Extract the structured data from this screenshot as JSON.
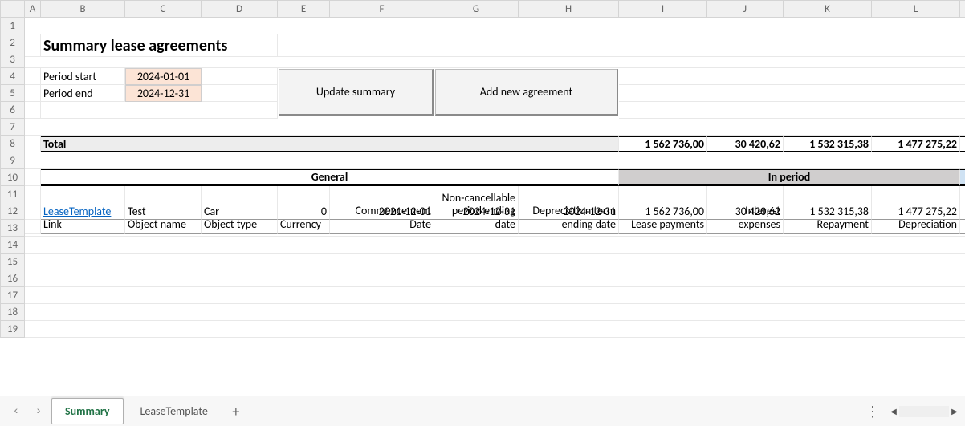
{
  "columns": [
    "A",
    "B",
    "C",
    "D",
    "E",
    "F",
    "G",
    "H",
    "I",
    "J",
    "K",
    "L",
    ""
  ],
  "rows": [
    "1",
    "2",
    "3",
    "4",
    "5",
    "6",
    "7",
    "8",
    "9",
    "10",
    "11",
    "12",
    "13",
    "14",
    "15",
    "16",
    "17",
    "18",
    "19"
  ],
  "title": "Summary lease agreements",
  "period": {
    "start_label": "Period start",
    "end_label": "Period end",
    "start": "2024-01-01",
    "end": "2024-12-31"
  },
  "buttons": {
    "update": "Update summary",
    "addnew": "Add new agreement"
  },
  "total": {
    "label": "Total",
    "lease_payments": "1 562 736,00",
    "interest_expenses": "30 420,62",
    "repayment": "1 532 315,38",
    "depreciation": "1 477 275,22"
  },
  "sections": {
    "general": "General",
    "in_period": "In period"
  },
  "headers": {
    "link": "Link",
    "object_name": "Object name",
    "object_type": "Object type",
    "currency": "Currency",
    "commencement_date": "Commencement Date",
    "noncancel_date": "Non-cancellable period ending date",
    "deprec_term_date": "Depreciation term ending date",
    "lease_payments": "Lease payments",
    "interest_expenses": "Interest expenses",
    "repayment": "Repayment",
    "depreciation": "Depreciation"
  },
  "data_rows": [
    {
      "link": "LeaseTemplate",
      "object_name": "Test",
      "object_type": "Car",
      "currency": "0",
      "commencement_date": "2021-12-01",
      "noncancel_date": "2024-12-31",
      "deprec_term_date": "2024-12-31",
      "lease_payments": "1 562 736,00",
      "interest_expenses": "30 420,62",
      "repayment": "1 532 315,38",
      "depreciation": "1 477 275,22"
    }
  ],
  "tabs": {
    "active": "Summary",
    "other": "LeaseTemplate"
  },
  "chart_data": {
    "type": "table",
    "title": "Summary lease agreements",
    "columns": [
      "Link",
      "Object name",
      "Object type",
      "Currency",
      "Commencement Date",
      "Non-cancellable period ending date",
      "Depreciation term ending date",
      "Lease payments",
      "Interest expenses",
      "Repayment",
      "Depreciation"
    ],
    "rows": [
      [
        "LeaseTemplate",
        "Test",
        "Car",
        0,
        "2021-12-01",
        "2024-12-31",
        "2024-12-31",
        1562736.0,
        30420.62,
        1532315.38,
        1477275.22
      ]
    ],
    "totals": {
      "Lease payments": 1562736.0,
      "Interest expenses": 30420.62,
      "Repayment": 1532315.38,
      "Depreciation": 1477275.22
    }
  }
}
